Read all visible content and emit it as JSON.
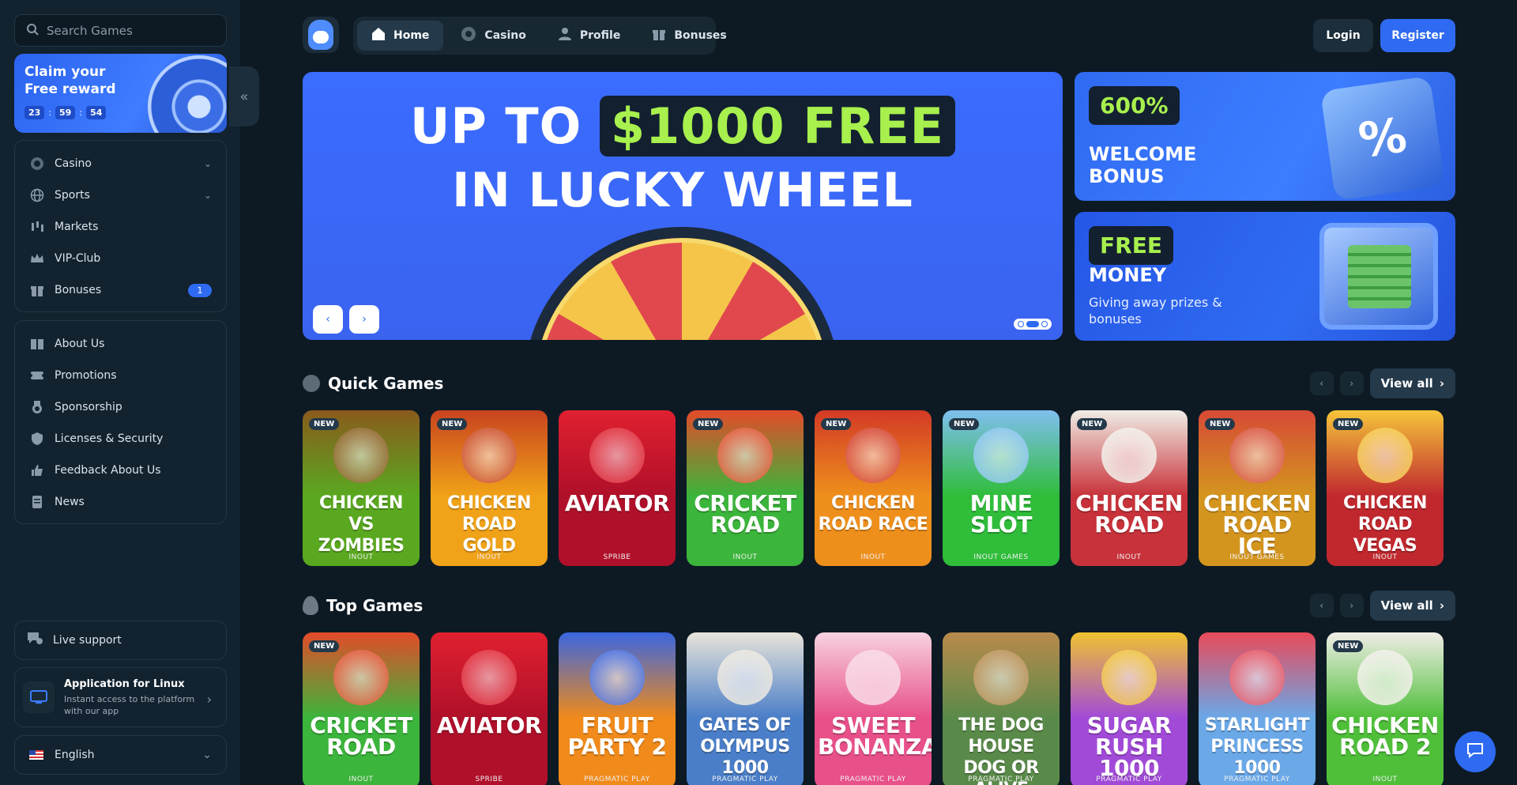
{
  "search": {
    "placeholder": "Search Games"
  },
  "reward": {
    "title": "Claim your Free reward",
    "hours": "23",
    "minutes": "59",
    "seconds": "54"
  },
  "sidebar": {
    "main": [
      {
        "label": "Casino",
        "icon": "casino-chip-icon",
        "has_chevron": true
      },
      {
        "label": "Sports",
        "icon": "globe-icon",
        "has_chevron": true
      },
      {
        "label": "Markets",
        "icon": "candlestick-icon"
      },
      {
        "label": "VIP-Club",
        "icon": "crown-icon"
      },
      {
        "label": "Bonuses",
        "icon": "gift-icon",
        "badge": "1"
      }
    ],
    "info": [
      {
        "label": "About Us",
        "icon": "book-icon"
      },
      {
        "label": "Promotions",
        "icon": "ticket-icon"
      },
      {
        "label": "Sponsorship",
        "icon": "medal-icon"
      },
      {
        "label": "Licenses & Security",
        "icon": "shield-icon"
      },
      {
        "label": "Feedback About Us",
        "icon": "thumbs-up-icon"
      },
      {
        "label": "News",
        "icon": "document-icon"
      }
    ],
    "support_label": "Live support",
    "app": {
      "title": "Application for Linux",
      "subtitle": "Instant access to the platform with our app"
    },
    "language": "English"
  },
  "header": {
    "tabs": [
      {
        "label": "Home",
        "icon": "home-icon",
        "active": true
      },
      {
        "label": "Casino",
        "icon": "casino-chip-icon"
      },
      {
        "label": "Profile",
        "icon": "user-icon"
      },
      {
        "label": "Bonuses",
        "icon": "gift-icon"
      }
    ],
    "login": "Login",
    "register": "Register"
  },
  "hero": {
    "line1_prefix": "UP TO",
    "line1_highlight": "$1000 FREE",
    "line2": "IN LUCKY WHEEL"
  },
  "promos": [
    {
      "pill": "600%",
      "title": "WELCOME BONUS"
    },
    {
      "pill": "FREE",
      "title": "MONEY",
      "subtitle": "Giving away prizes & bonuses"
    }
  ],
  "sections": {
    "quick": {
      "title": "Quick Games",
      "view_all": "View all",
      "games": [
        {
          "name": "CHICKEN VS ZOMBIES",
          "provider": "INOUT",
          "new": true,
          "bg": "#5aa820",
          "art": "#8a5a1c"
        },
        {
          "name": "CHICKEN ROAD GOLD",
          "provider": "INOUT",
          "new": true,
          "bg": "#f0a218",
          "art": "#c8431f"
        },
        {
          "name": "AVIATOR",
          "provider": "SPRIBE",
          "new": false,
          "bg": "#b0102a",
          "art": "#e0202f"
        },
        {
          "name": "CRICKET ROAD",
          "provider": "INOUT",
          "new": true,
          "bg": "#3bb53b",
          "art": "#e34b2a"
        },
        {
          "name": "CHICKEN ROAD RACE",
          "provider": "INOUT",
          "new": true,
          "bg": "#ee8f1c",
          "art": "#d23a26"
        },
        {
          "name": "MINE SLOT",
          "provider": "INOUT GAMES",
          "new": true,
          "bg": "#2fbd3a",
          "art": "#7fbff0"
        },
        {
          "name": "CHICKEN ROAD",
          "provider": "INOUT",
          "new": true,
          "bg": "#c8323a",
          "art": "#f0ede6"
        },
        {
          "name": "CHICKEN ROAD ICE",
          "provider": "INOUT GAMES",
          "new": true,
          "bg": "#d4951e",
          "art": "#d64a36"
        },
        {
          "name": "CHICKEN ROAD VEGAS",
          "provider": "INOUT",
          "new": true,
          "bg": "#c0282e",
          "art": "#f5c53a"
        }
      ]
    },
    "top": {
      "title": "Top Games",
      "view_all": "View all",
      "games": [
        {
          "name": "CRICKET ROAD",
          "provider": "INOUT",
          "new": true,
          "bg": "#3bb53b",
          "art": "#e34b2a"
        },
        {
          "name": "AVIATOR",
          "provider": "SPRIBE",
          "new": false,
          "bg": "#b0102a",
          "art": "#e0202f"
        },
        {
          "name": "FRUIT PARTY 2",
          "provider": "PRAGMATIC PLAY",
          "new": false,
          "bg": "#f08a1a",
          "art": "#3a66e0"
        },
        {
          "name": "GATES OF OLYMPUS 1000",
          "provider": "PRAGMATIC PLAY",
          "new": false,
          "bg": "#4a7ec8",
          "art": "#e8e4da"
        },
        {
          "name": "SWEET BONANZA",
          "provider": "PRAGMATIC PLAY",
          "new": false,
          "bg": "#e8508a",
          "art": "#f7d2e0"
        },
        {
          "name": "THE DOG HOUSE DOG OR ALIVE",
          "provider": "PRAGMATIC PLAY",
          "new": false,
          "bg": "#5a8a4a",
          "art": "#b98a4c"
        },
        {
          "name": "SUGAR RUSH 1000",
          "provider": "PRAGMATIC PLAY",
          "new": false,
          "bg": "#a24ad8",
          "art": "#f0c230"
        },
        {
          "name": "STARLIGHT PRINCESS 1000",
          "provider": "PRAGMATIC PLAY",
          "new": false,
          "bg": "#6aa8e8",
          "art": "#e84a5a"
        },
        {
          "name": "CHICKEN ROAD 2",
          "provider": "INOUT",
          "new": true,
          "bg": "#4fbf3a",
          "art": "#f0ede6"
        }
      ]
    }
  },
  "colors": {
    "accent": "#2f6bf2",
    "lime": "#a8f04e",
    "bg": "#0d1a24",
    "sidebar": "#12222e"
  }
}
